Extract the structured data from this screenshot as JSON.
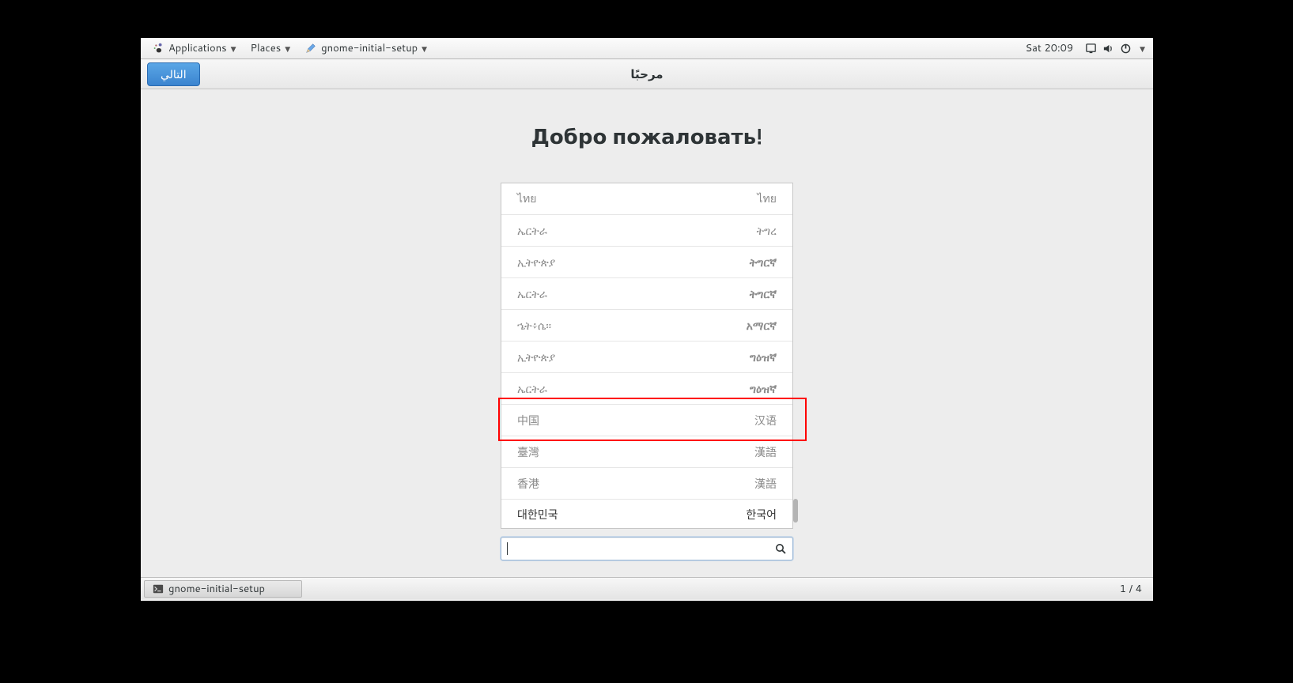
{
  "panel": {
    "applications": "Applications",
    "places": "Places",
    "app_menu": "gnome-initial-setup",
    "clock": "Sat 20:09"
  },
  "header": {
    "next_button": "التالي",
    "title": "مرحبًا"
  },
  "welcome": {
    "title": "Добро пожаловать!"
  },
  "languages": [
    {
      "country": "ไทย",
      "lang": "ไทย",
      "bold": false,
      "dark": false
    },
    {
      "country": "ኤርትራ",
      "lang": "ትግረ",
      "bold": false,
      "dark": false
    },
    {
      "country": "ኢትዮጵያ",
      "lang": "ትግርኛ",
      "bold": true,
      "dark": false
    },
    {
      "country": "ኤርትራ",
      "lang": "ትግርኛ",
      "bold": true,
      "dark": false
    },
    {
      "country": "ኄት፥ሴ፡፡",
      "lang": "አማርኛ",
      "bold": true,
      "dark": false
    },
    {
      "country": "ኢትዮጵያ",
      "lang": "ግዕዝኛ",
      "bold": true,
      "dark": false
    },
    {
      "country": "ኤርትራ",
      "lang": "ግዕዝኛ",
      "bold": true,
      "dark": false
    },
    {
      "country": "中国",
      "lang": "汉语",
      "bold": false,
      "dark": false
    },
    {
      "country": "臺灣",
      "lang": "漢語",
      "bold": false,
      "dark": false
    },
    {
      "country": "香港",
      "lang": "漢語",
      "bold": false,
      "dark": false
    },
    {
      "country": "대한민국",
      "lang": "한국어",
      "bold": false,
      "dark": true
    }
  ],
  "highlight_index": 7,
  "search": {
    "value": ""
  },
  "taskbar": {
    "task": "gnome-initial-setup",
    "workspace": "1 / 4"
  }
}
